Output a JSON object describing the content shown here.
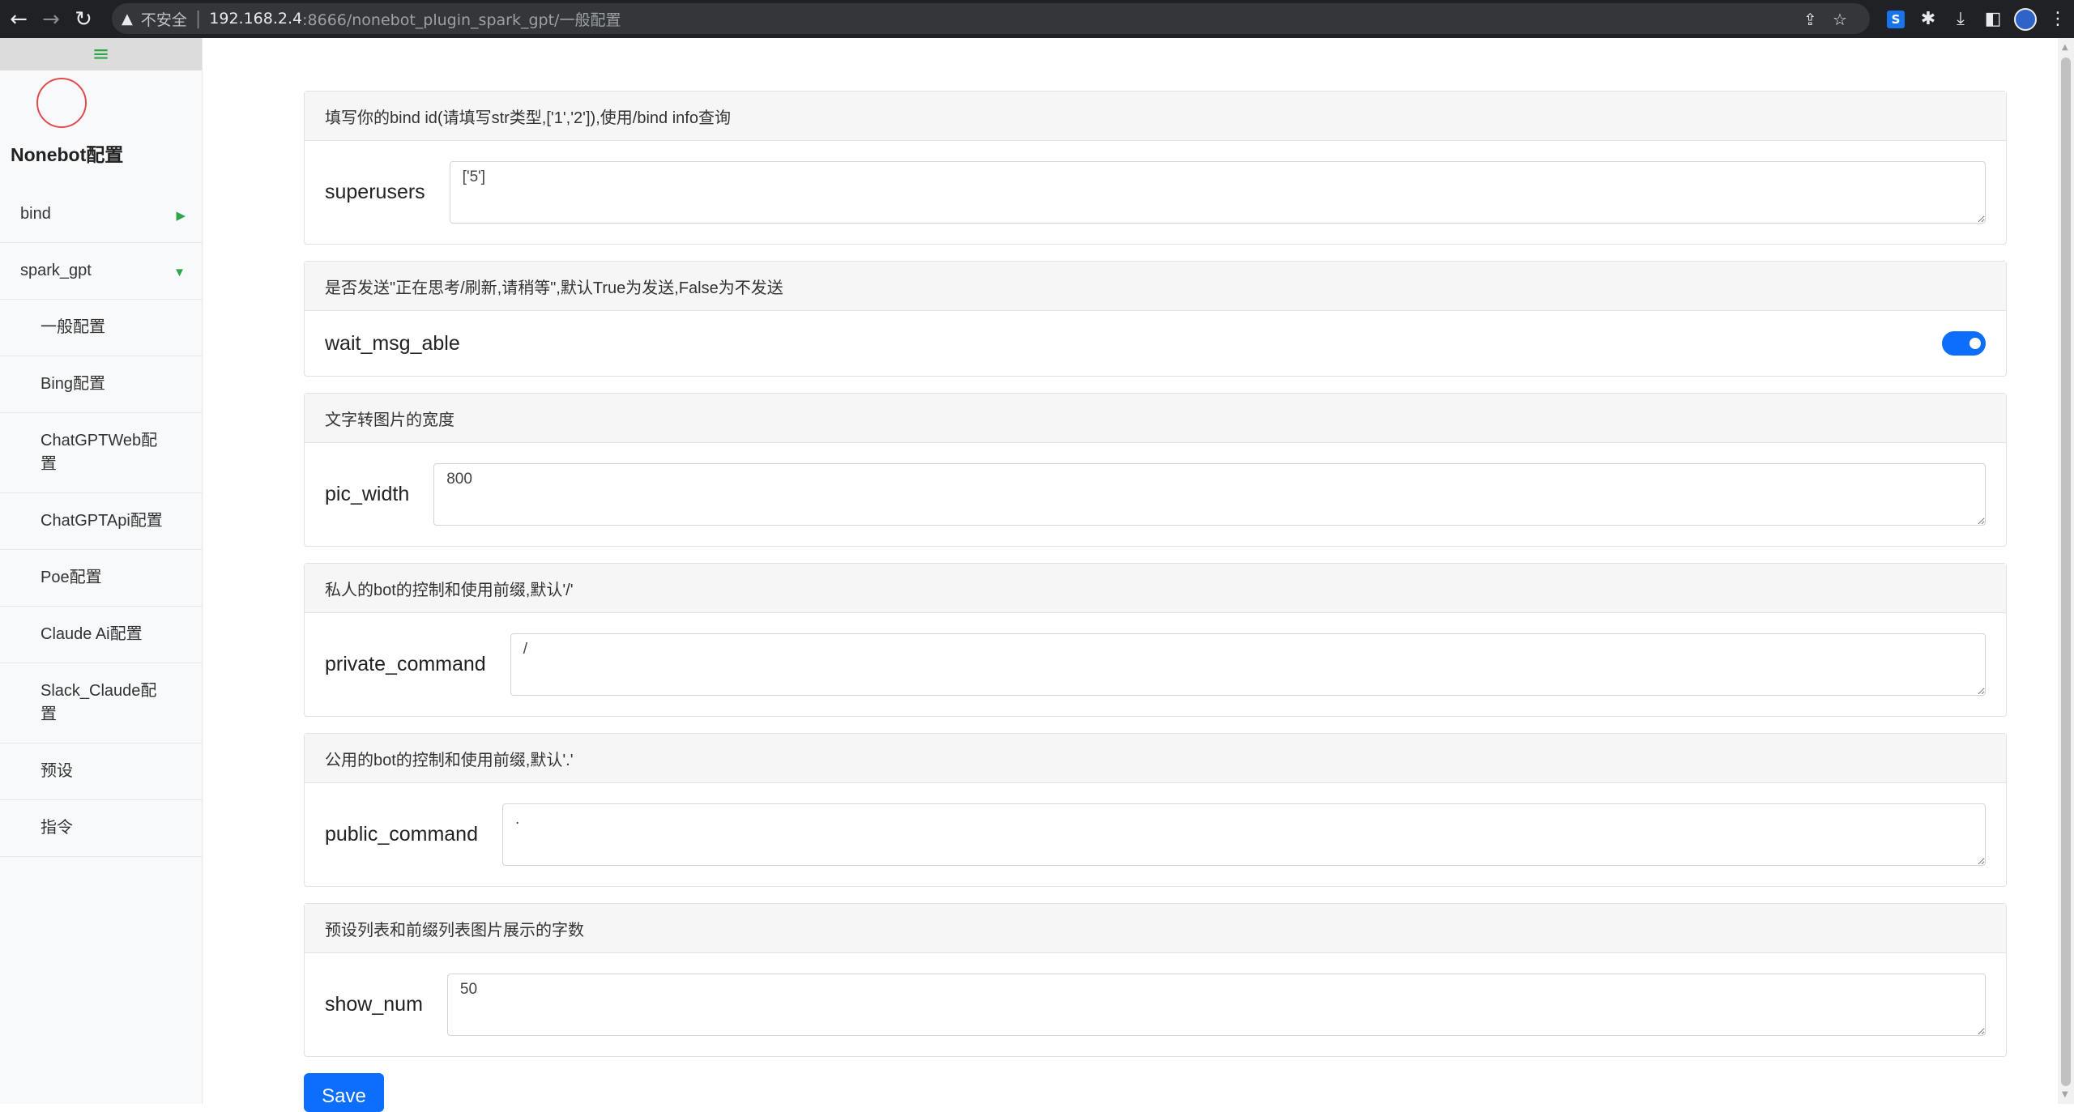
{
  "browser": {
    "back_icon": "arrow-left",
    "forward_icon": "arrow-right",
    "reload_icon": "reload",
    "insecure_label": "不安全",
    "url_host": "192.168.2.4",
    "url_path": ":8666/nonebot_plugin_spark_gpt/一般配置"
  },
  "sidebar": {
    "toggle_icon": "≡",
    "title": "Nonebot配置",
    "items": [
      {
        "label": "bind",
        "level": "top",
        "arrow": "▶"
      },
      {
        "label": "spark_gpt",
        "level": "top",
        "arrow": "▼"
      },
      {
        "label": "一般配置",
        "level": "sub"
      },
      {
        "label": "Bing配置",
        "level": "sub"
      },
      {
        "label": "ChatGPTWeb配置",
        "level": "sub"
      },
      {
        "label": "ChatGPTApi配置",
        "level": "sub"
      },
      {
        "label": "Poe配置",
        "level": "sub"
      },
      {
        "label": "Claude Ai配置",
        "level": "sub"
      },
      {
        "label": "Slack_Claude配置",
        "level": "sub"
      },
      {
        "label": "预设",
        "level": "sub"
      },
      {
        "label": "指令",
        "level": "sub"
      }
    ]
  },
  "main": {
    "fields": [
      {
        "description": "填写你的bind id(请填写str类型,['1','2']),使用/bind info查询",
        "name": "superusers",
        "value": "['5']"
      },
      {
        "description": "是否发送\"正在思考/刷新,请稍等\",默认True为发送,False为不发送",
        "name": "wait_msg_able",
        "toggle": true
      },
      {
        "description": "文字转图片的宽度",
        "name": "pic_width",
        "value": "800"
      },
      {
        "description": "私人的bot的控制和使用前缀,默认'/'",
        "name": "private_command",
        "value": "/"
      },
      {
        "description": "公用的bot的控制和使用前缀,默认'.'",
        "name": "public_command",
        "value": "."
      },
      {
        "description": "预设列表和前缀列表图片展示的字数",
        "name": "show_num",
        "value": "50"
      }
    ],
    "save_label": "Save"
  },
  "colors": {
    "accent": "#0d6efd",
    "sidebar_arrow": "#2fa54a",
    "logo_ring": "#e04b4b"
  }
}
